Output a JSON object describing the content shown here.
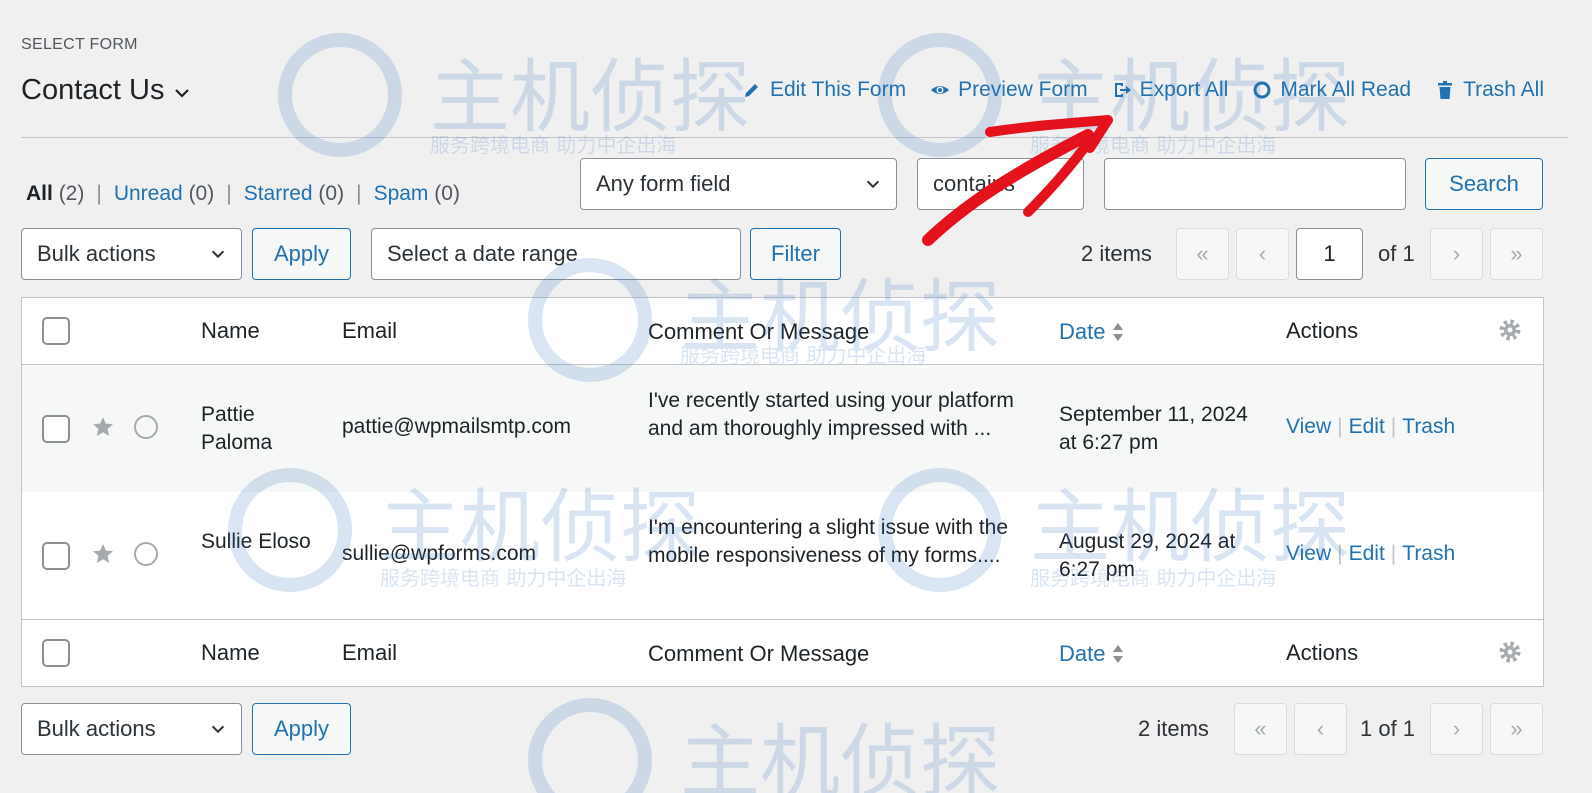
{
  "header": {
    "select_form_label": "SELECT FORM",
    "form_title": "Contact Us",
    "actions": [
      {
        "label": "Edit This Form",
        "icon": "pencil-icon"
      },
      {
        "label": "Preview Form",
        "icon": "eye-icon"
      },
      {
        "label": "Export All",
        "icon": "export-icon"
      },
      {
        "label": "Mark All Read",
        "icon": "circle-icon"
      },
      {
        "label": "Trash All",
        "icon": "trash-icon"
      }
    ]
  },
  "views": {
    "all": {
      "label": "All",
      "count": "(2)"
    },
    "unread": {
      "label": "Unread",
      "count": "(0)"
    },
    "starred": {
      "label": "Starred",
      "count": "(0)"
    },
    "spam": {
      "label": "Spam",
      "count": "(0)"
    },
    "separator": "|"
  },
  "search": {
    "field_select": "Any form field",
    "operator_select": "contains",
    "query": "",
    "button": "Search"
  },
  "toolbar_top": {
    "bulk_actions": "Bulk actions",
    "apply": "Apply",
    "date_range_placeholder": "Select a date range",
    "filter": "Filter",
    "items_count": "2 items",
    "first": "«",
    "prev": "‹",
    "current_page": "1",
    "of_pages": "of 1",
    "next": "›",
    "last": "»"
  },
  "table": {
    "columns": {
      "name": "Name",
      "email": "Email",
      "message": "Comment Or Message",
      "date": "Date",
      "actions": "Actions"
    },
    "rows": [
      {
        "name": "Pattie Paloma",
        "email": "pattie@wpmailsmtp.com",
        "message": "I've recently started using your platform and am thoroughly impressed with ...",
        "date": "September 11, 2024 at 6:27 pm",
        "view": "View",
        "edit": "Edit",
        "trash": "Trash",
        "sep": "|"
      },
      {
        "name": "Sullie Eloso",
        "email": "sullie@wpforms.com",
        "message": "I'm encountering a slight issue with the mobile responsiveness of my forms....",
        "date": "August 29, 2024 at 6:27 pm",
        "view": "View",
        "edit": "Edit",
        "trash": "Trash",
        "sep": "|"
      }
    ]
  },
  "toolbar_bottom": {
    "bulk_actions": "Bulk actions",
    "apply": "Apply",
    "items_count": "2 items",
    "first": "«",
    "prev": "‹",
    "page_label": "1 of 1",
    "next": "›",
    "last": "»"
  },
  "watermark": {
    "logo_text": "主机侦探",
    "tagline": "服务跨境电商 助力中企出海"
  },
  "colors": {
    "link": "#2271b1",
    "background": "#f0f0f1",
    "annotation_arrow": "#e3121c"
  }
}
